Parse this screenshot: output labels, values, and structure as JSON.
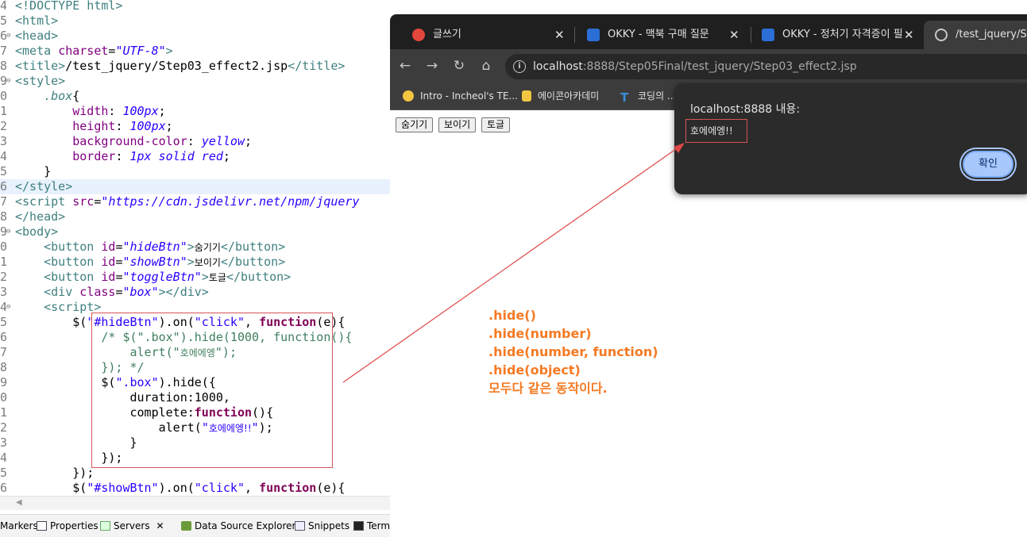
{
  "editor": {
    "line_numbers": [
      "4",
      "5",
      "6",
      "7",
      "8",
      "9",
      "0",
      "1",
      "2",
      "3",
      "4",
      "5",
      "6",
      "7",
      "8",
      "9",
      "0",
      "1",
      "2",
      "3",
      "4",
      "5",
      "6",
      "7",
      "8",
      "9",
      "0",
      "1",
      "2",
      "3",
      "4",
      "5",
      "6"
    ],
    "code": {
      "l1_doctype": "<!DOCTYPE html>",
      "l2": "<html>",
      "l3": "<head>",
      "l4_a": "<meta",
      "l4_b": "charset",
      "l4_c": "=",
      "l4_d": "\"UTF-8\"",
      "l4_e": ">",
      "l5_a": "<title>",
      "l5_b": "/test_jquery/Step03_effect2.jsp",
      "l5_c": "</title>",
      "l6": "<style>",
      "l7_sel": ".box",
      "l7_brace": "{",
      "l8_prop": "width",
      "l8_val": "100px",
      "l9_prop": "height",
      "l9_val": "100px",
      "l10_prop": "background-color",
      "l10_val": "yellow",
      "l11_prop": "border",
      "l11_val": "1px solid red",
      "l12": "}",
      "l13": "</style>",
      "l14_a": "<script",
      "l14_b": "src",
      "l14_c": "\"https://cdn.jsdelivr.net/npm/jquery",
      "l15": "</head>",
      "l16": "<body>",
      "btn1_a": "<button",
      "btn1_id": "\"hideBtn\"",
      "btn1_text": "숨기기",
      "btn2_id": "\"showBtn\"",
      "btn2_text": "보이기",
      "btn3_id": "\"toggleBtn\"",
      "btn3_text": "토글",
      "btn_close": "</button>",
      "attr_id": "id",
      "div_a": "<div",
      "div_attr": "class",
      "div_val": "\"box\"",
      "div_close": "></div>",
      "script_open": "<script>",
      "js1_a": "$(",
      "js1_sel": "\"#hideBtn\"",
      "js1_b": ").on(",
      "js1_evt": "\"click\"",
      "js1_c": ", ",
      "js_kw_function": "function",
      "js1_d": "(e){",
      "com1": "/* $(\".box\").hide(1000, function(){",
      "com2_a": "alert(\"",
      "com2_ko": "호에에엥",
      "com2_b": "\");",
      "com3": "}); */",
      "js2_a": "$(",
      "js2_sel": "\".box\"",
      "js2_b": ").hide({",
      "js3": "duration:1000,",
      "js4_a": "complete:",
      "js4_b": "(){",
      "js5_a": "alert(",
      "js5_str_a": "\"",
      "js5_ko": "호에에엥!!",
      "js5_str_b": "\"",
      "js5_b": ");",
      "js6": "}",
      "js7": "});",
      "js8": "});",
      "js9_sel": "\"#showBtn\""
    },
    "views": [
      "Markers",
      "Properties",
      "Servers",
      "Data Source Explorer",
      "Snippets",
      "Termi"
    ]
  },
  "browser": {
    "tabs": [
      {
        "title": "글쓰기",
        "icon": "okky-red-icon"
      },
      {
        "title": "OKKY - 맥북 구매 질문",
        "icon": "okky-blue-icon"
      },
      {
        "title": "OKKY - 정처기 자격증이 필",
        "icon": "okky-blue-icon"
      },
      {
        "title": "/test_jquery/Step",
        "icon": "globe-icon"
      }
    ],
    "url_host": "localhost",
    "url_rest": ":8888/Step05Final/test_jquery/Step03_effect2.jsp",
    "bookmarks": [
      "Intro - Incheol's TE...",
      "에이콘아카데미",
      "코딩의 ..."
    ],
    "page_buttons": [
      "숨기기",
      "보이기",
      "토글"
    ],
    "colors": {
      "accent_blue": "#a8c7fa",
      "annotation_orange": "#f57a23",
      "highlight_red": "#d9535a"
    }
  },
  "dialog": {
    "title": "localhost:8888 내용:",
    "message": "호에에엥!!",
    "ok_label": "확인"
  },
  "note": {
    "lines": [
      ".hide()",
      ".hide(number)",
      ".hide(number, function)",
      ".hide(object)",
      "모두다 같은 동작이다."
    ]
  }
}
